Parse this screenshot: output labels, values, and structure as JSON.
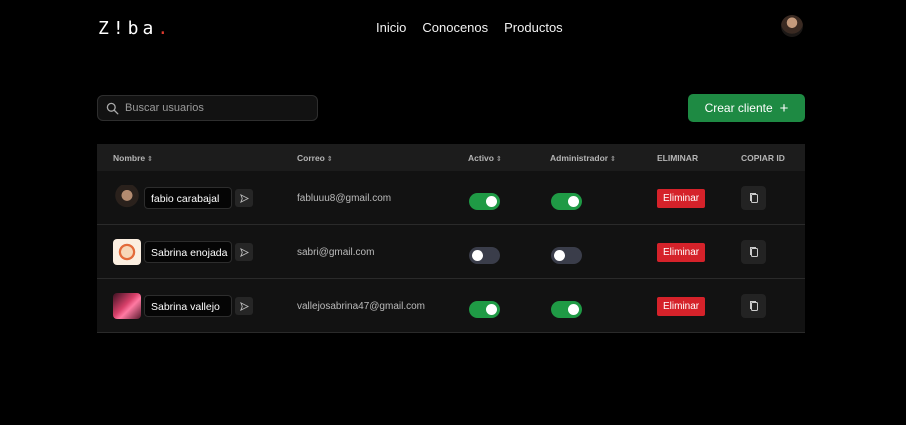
{
  "brand": {
    "logo_text": "Z!ba",
    "logo_dot": "."
  },
  "nav": {
    "items": [
      "Inicio",
      "Conocenos",
      "Productos"
    ]
  },
  "search": {
    "placeholder": "Buscar usuarios"
  },
  "create_button": {
    "label": "Crear cliente",
    "icon": "+"
  },
  "table": {
    "headers": {
      "nombre": "Nombre",
      "correo": "Correo",
      "activo": "Activo",
      "administrador": "Administrador",
      "eliminar": "ELIMINAR",
      "copiar": "COPIAR ID"
    },
    "sort_icon": "⇕",
    "rows": [
      {
        "name": "fabio carabajal",
        "email": "fabluuu8@gmail.com",
        "activo": true,
        "administrador": true,
        "delete_label": "Eliminar",
        "avatar": "dark-portrait"
      },
      {
        "name": "Sabrina enojada",
        "email": "sabri@gmail.com",
        "activo": false,
        "administrador": false,
        "delete_label": "Eliminar",
        "avatar": "cartoon-portrait"
      },
      {
        "name": "Sabrina vallejo",
        "email": "vallejosabrina47@gmail.com",
        "activo": true,
        "administrador": true,
        "delete_label": "Eliminar",
        "avatar": "pink-portrait"
      }
    ]
  },
  "colors": {
    "accent_green": "#1e8a43",
    "danger_red": "#d5222a",
    "toggle_on": "#1f9a45",
    "toggle_off": "#3a3d4a"
  }
}
